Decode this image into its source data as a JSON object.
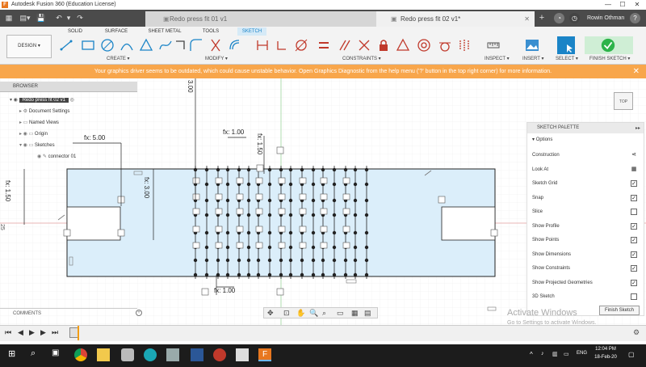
{
  "window": {
    "title": "Autodesk Fusion 360 (Education License)",
    "logo": "F",
    "app_icon": "fusion-logo-icon"
  },
  "tabs": [
    {
      "label": "Redo press fit 01 v1",
      "active": false
    },
    {
      "label": "Redo press fit 02 v1*",
      "active": true
    }
  ],
  "user": {
    "name": "Rowin Othman",
    "avatar_icon": "avatar-icon"
  },
  "toolbar": {
    "workspace": "DESIGN ▾",
    "workspace_tabs": [
      "SOLID",
      "SURFACE",
      "SHEET METAL",
      "TOOLS",
      "SKETCH"
    ],
    "active_tab": "SKETCH",
    "groups": {
      "create": "CREATE ▾",
      "modify": "MODIFY ▾",
      "constraints": "CONSTRAINTS ▾",
      "inspect": "INSPECT ▾",
      "insert": "INSERT ▾",
      "select": "SELECT ▾",
      "finish": "FINISH SKETCH ▾"
    }
  },
  "warning": {
    "text": "Your graphics driver seems to be outdated, which could cause unstable behavior. Open Graphics Diagnostic from the help menu ('?' button in the top right corner) for more information.",
    "close": "✕"
  },
  "browser": {
    "header": "BROWSER",
    "root": "Redo press fit 02 v1",
    "items": [
      "Document Settings",
      "Named Views",
      "Origin",
      "Sketches",
      "connector 01"
    ]
  },
  "comments": {
    "label": "COMMENTS"
  },
  "dimensions": {
    "d1": "fx: 5.00",
    "d2": "fx: 1.50",
    "d3": "fx: 3.00",
    "d4": "fx: 1.00",
    "d5": "fx: 1.50",
    "d6": "fx: 1.00",
    "d7": "3.00",
    "d8": "25"
  },
  "viewcube": {
    "label": "TOP"
  },
  "palette": {
    "header": "SKETCH PALETTE",
    "section": "Options",
    "rows": [
      {
        "label": "Construction",
        "type": "icon"
      },
      {
        "label": "Look At",
        "type": "icon"
      },
      {
        "label": "Sketch Grid",
        "type": "check",
        "checked": true
      },
      {
        "label": "Snap",
        "type": "check",
        "checked": true
      },
      {
        "label": "Slice",
        "type": "check",
        "checked": false
      },
      {
        "label": "Show Profile",
        "type": "check",
        "checked": true
      },
      {
        "label": "Show Points",
        "type": "check",
        "checked": true
      },
      {
        "label": "Show Dimensions",
        "type": "check",
        "checked": true
      },
      {
        "label": "Show Constraints",
        "type": "check",
        "checked": true
      },
      {
        "label": "Show Projected Geometries",
        "type": "check",
        "checked": true
      },
      {
        "label": "3D Sketch",
        "type": "check",
        "checked": false
      }
    ],
    "finish": "Finish Sketch"
  },
  "activation": {
    "title": "Activate Windows",
    "subtitle": "Go to Settings to activate Windows."
  },
  "taskbar": {
    "lang": "ENG",
    "time": "12:04 PM",
    "date": "18-Feb-20"
  }
}
